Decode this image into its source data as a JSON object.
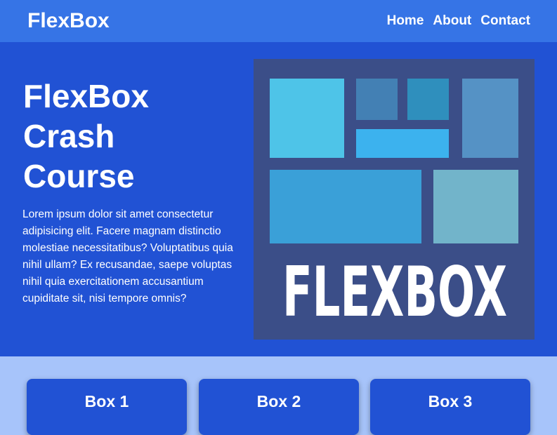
{
  "navbar": {
    "logo": "FlexBox",
    "links": [
      "Home",
      "About",
      "Contact"
    ]
  },
  "hero": {
    "title": "FlexBox Crash Course",
    "text": "Lorem ipsum dolor sit amet consectetur adipisicing elit. Facere magnam distinctio molestiae necessitatibus? Voluptatibus quia nihil ullam? Ex recusandae, saepe voluptas nihil quia exercitationem accusantium cupiditate sit, nisi tempore omnis?",
    "image_text": "FLEXBOX"
  },
  "features": {
    "boxes": [
      "Box 1",
      "Box 2",
      "Box 3"
    ]
  },
  "colors": {
    "navbar_bg": "#3674e6",
    "hero_bg": "#2152d4",
    "page_bg": "#a7c4fa",
    "logo_panel_bg": "#3b4e88"
  }
}
